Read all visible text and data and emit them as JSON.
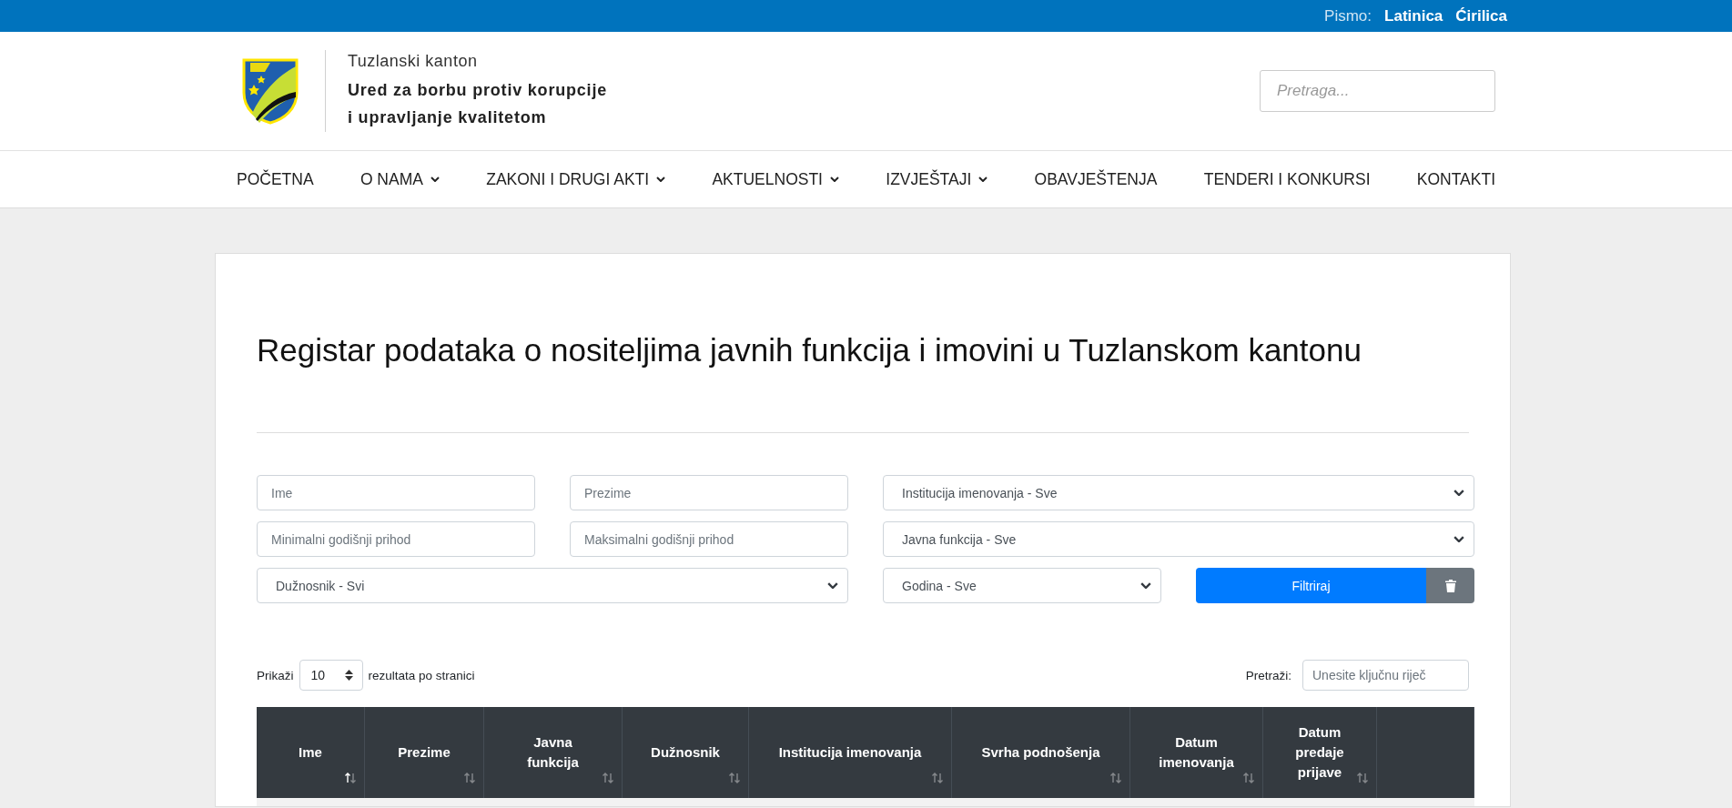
{
  "topbar": {
    "label": "Pismo:",
    "scripts": [
      "Latinica",
      "Ćirilica"
    ]
  },
  "header": {
    "region": "Tuzlanski kanton",
    "office_lines": [
      "Ured za borbu protiv korupcije",
      "i upravljanje kvalitetom"
    ],
    "search": {
      "placeholder": "Pretraga..."
    }
  },
  "nav": [
    {
      "label": "POČETNA",
      "dropdown": false
    },
    {
      "label": "O NAMA",
      "dropdown": true
    },
    {
      "label": "ZAKONI I DRUGI AKTI",
      "dropdown": true
    },
    {
      "label": "AKTUELNOSTI",
      "dropdown": true
    },
    {
      "label": "IZVJEŠTAJI",
      "dropdown": true
    },
    {
      "label": "OBAVJEŠTENJA",
      "dropdown": false
    },
    {
      "label": "TENDERI I KONKURSI",
      "dropdown": false
    },
    {
      "label": "KONTAKTI",
      "dropdown": false
    }
  ],
  "title": "Registar podataka o nositeljima javnih funkcija i imovini u Tuzlanskom kantonu",
  "filters": {
    "first_name": {
      "placeholder": "Ime"
    },
    "last_name": {
      "placeholder": "Prezime"
    },
    "institution": {
      "value": "Institucija imenovanja - Sve"
    },
    "min_income": {
      "placeholder": "Minimalni godišnji prihod"
    },
    "max_income": {
      "placeholder": "Maksimalni godišnji prihod"
    },
    "function": {
      "value": "Javna funkcija - Sve"
    },
    "official": {
      "value": "Dužnosnik - Svi"
    },
    "year": {
      "value": "Godina - Sve"
    },
    "submit": "Filtriraj"
  },
  "length": {
    "before": "Prikaži",
    "value": "10",
    "after": "rezultata po stranici"
  },
  "table_search": {
    "label": "Pretraži:",
    "placeholder": "Unesite ključnu riječ"
  },
  "table": {
    "columns": [
      {
        "label": "Ime",
        "sorted": true
      },
      {
        "label": "Prezime",
        "sorted": false
      },
      {
        "label": "Javna funkcija",
        "sorted": false
      },
      {
        "label": "Dužnosnik",
        "sorted": false
      },
      {
        "label": "Institucija imenovanja",
        "sorted": false
      },
      {
        "label": "Svrha podnošenja",
        "sorted": false
      },
      {
        "label": "Datum imenovanja",
        "sorted": false
      },
      {
        "label": "Datum predaje prijave",
        "sorted": false
      }
    ]
  }
}
